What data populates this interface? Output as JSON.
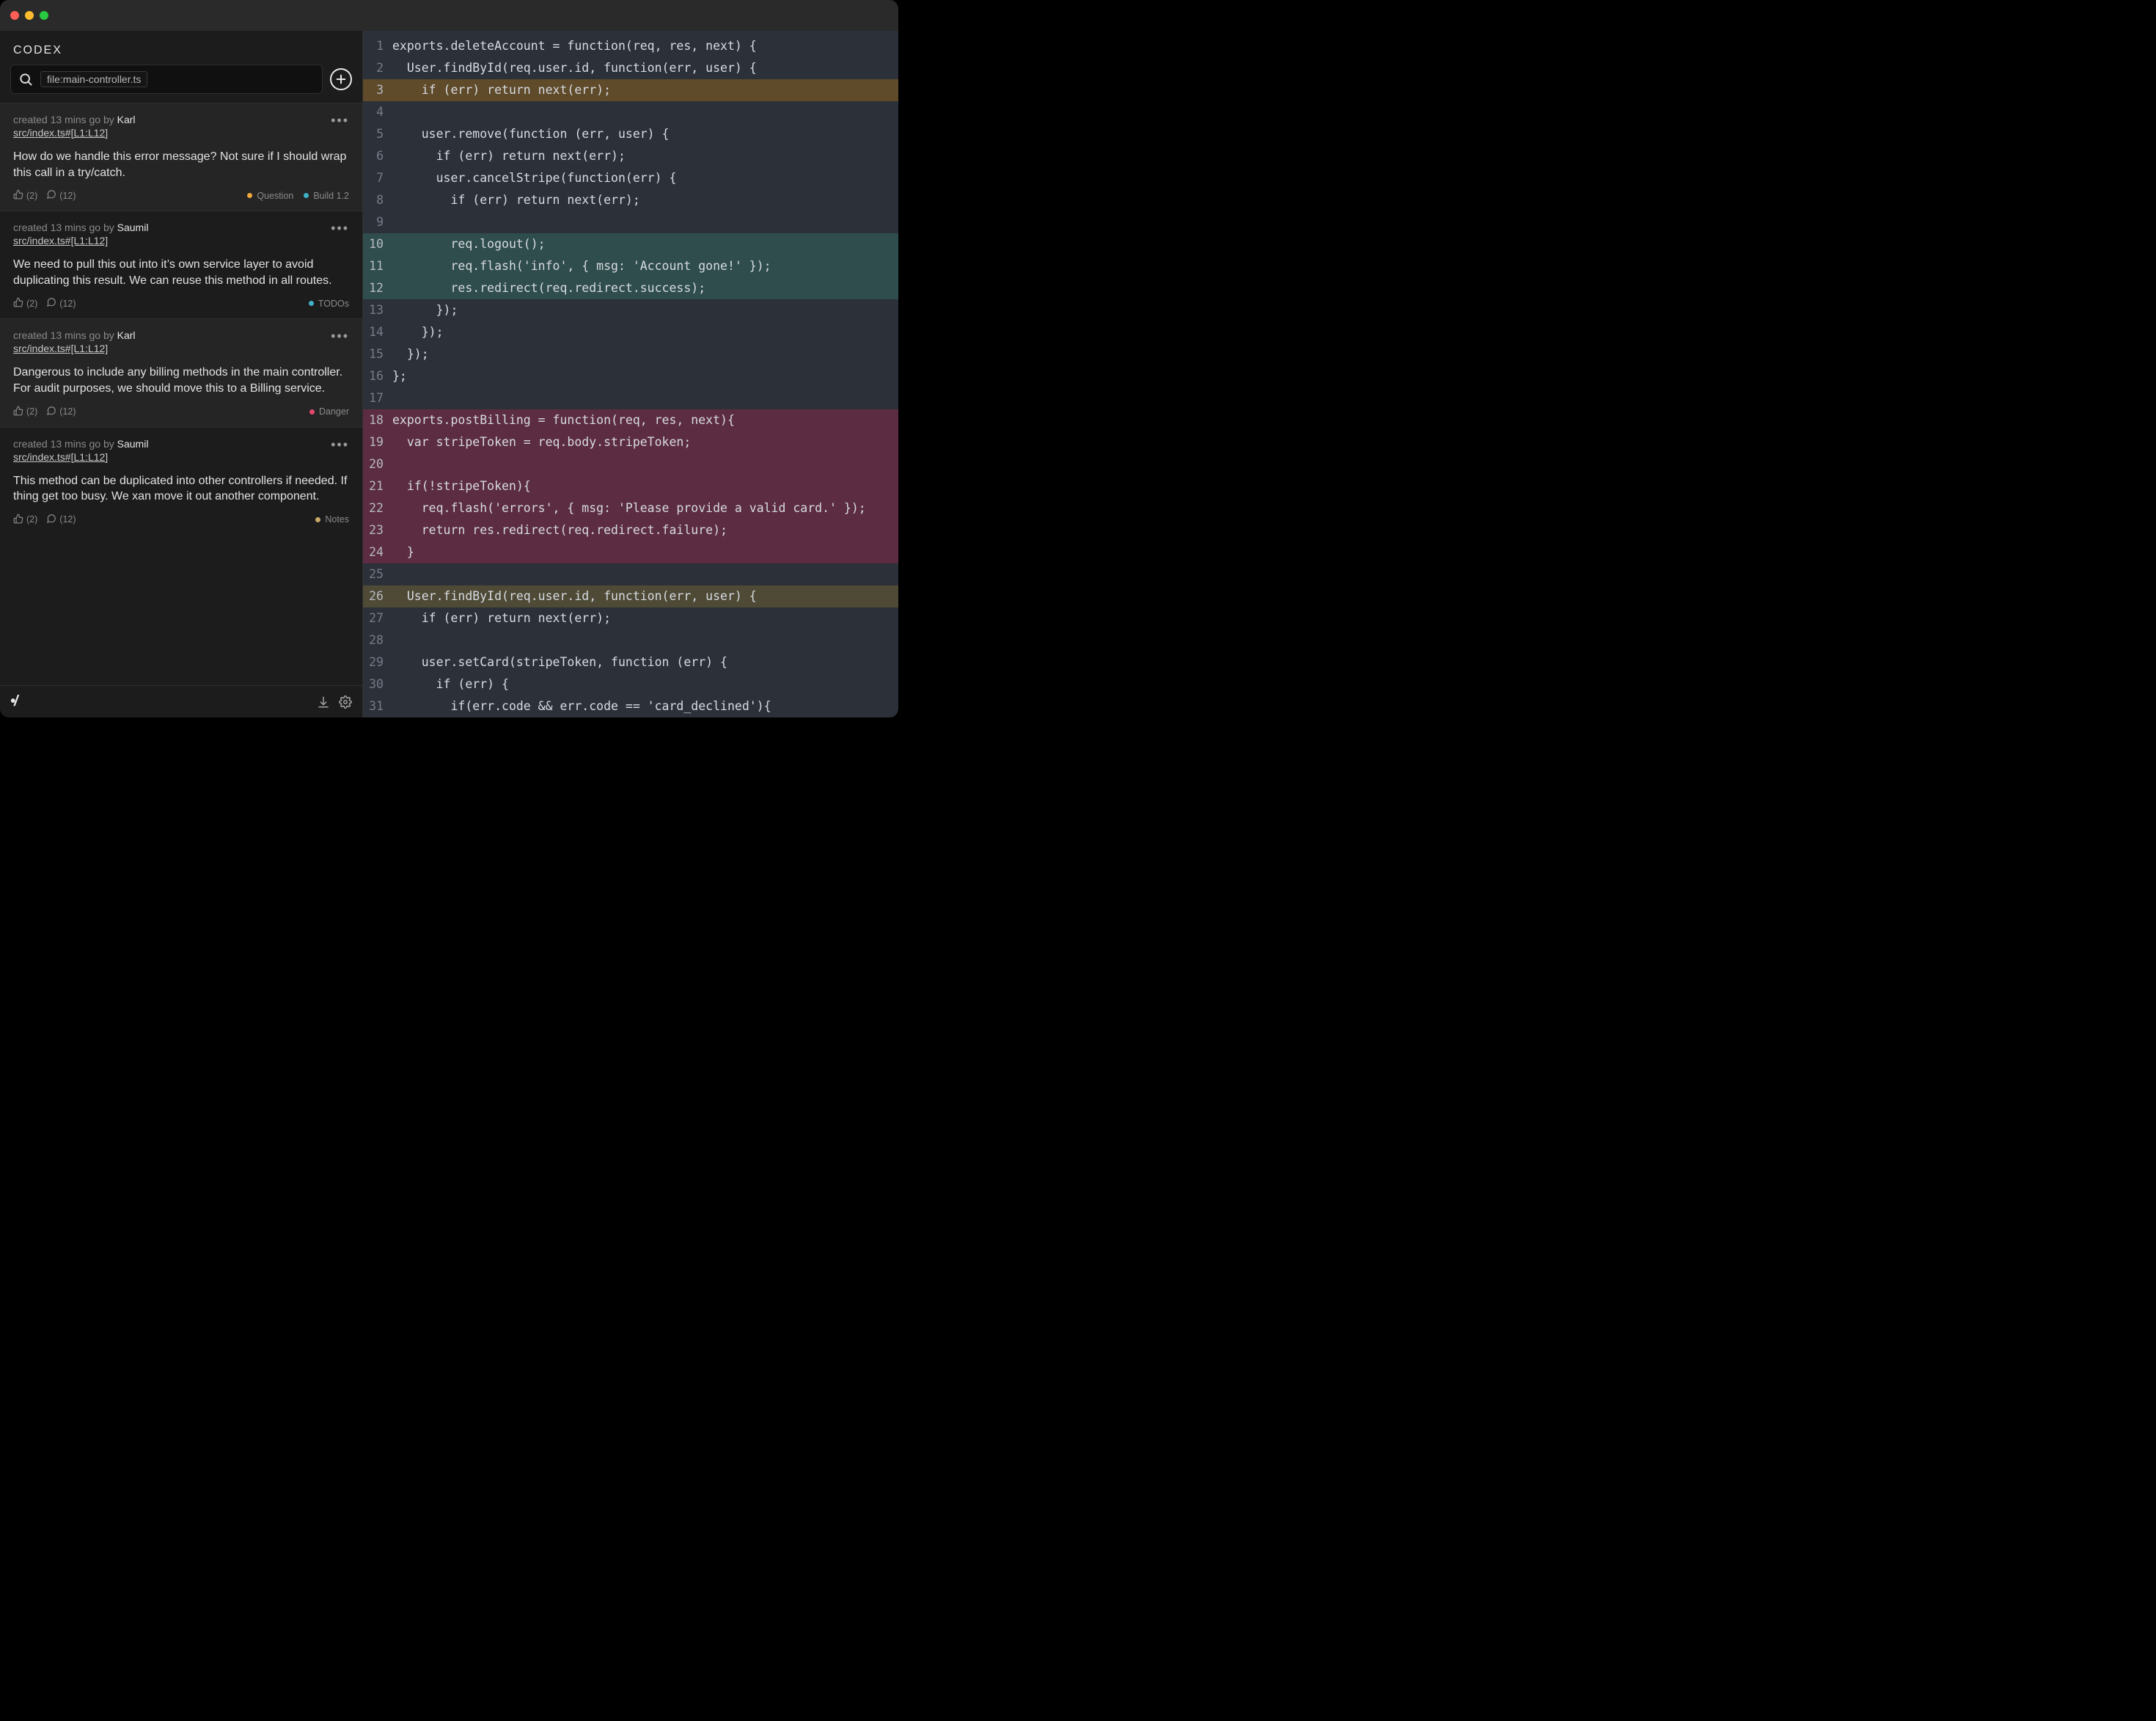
{
  "app": {
    "title": "CODEX"
  },
  "search": {
    "chip": "file:main-controller.ts"
  },
  "colors": {
    "question": "#f0a93a",
    "build": "#3fb2c9",
    "todos": "#3fb2c9",
    "danger": "#e7486f",
    "notes": "#c8a96a"
  },
  "cards": [
    {
      "alt": true,
      "created": "created 13 mins go by ",
      "author": "Karl",
      "file": "src/index.ts#[L1:L12]",
      "text": "How do we handle this error message? Not sure if I should wrap this call in a try/catch.",
      "likes": "(2)",
      "comments": "(12)",
      "tags": [
        {
          "label": "Question",
          "colorKey": "question"
        },
        {
          "label": "Build 1.2",
          "colorKey": "build"
        }
      ]
    },
    {
      "alt": false,
      "created": "created 13 mins go by ",
      "author": "Saumil",
      "file": "src/index.ts#[L1:L12]",
      "text": "We need to pull this out into it’s own service layer to avoid duplicating this result. We can reuse this method in all routes.",
      "likes": "(2)",
      "comments": "(12)",
      "tags": [
        {
          "label": "TODOs",
          "colorKey": "todos"
        }
      ]
    },
    {
      "alt": true,
      "created": "created 13 mins go by ",
      "author": "Karl",
      "file": "src/index.ts#[L1:L12]",
      "text": "Dangerous to include any billing methods in the main controller. For audit purposes, we should move this to a Billing service.",
      "likes": "(2)",
      "comments": "(12)",
      "tags": [
        {
          "label": "Danger",
          "colorKey": "danger"
        }
      ]
    },
    {
      "alt": false,
      "created": "created 13 mins go by ",
      "author": "Saumil",
      "file": "src/index.ts#[L1:L12]",
      "text": "This method can be duplicated into other controllers if needed. If thing get too busy. We xan move it out another component.",
      "likes": "(2)",
      "comments": "(12)",
      "tags": [
        {
          "label": "Notes",
          "colorKey": "notes"
        }
      ]
    }
  ],
  "code_lines": [
    {
      "n": 1,
      "t": "exports.deleteAccount = function(req, res, next) {"
    },
    {
      "n": 2,
      "t": "  User.findById(req.user.id, function(err, user) {"
    },
    {
      "n": 3,
      "t": "    if (err) return next(err);",
      "hl": "brown"
    },
    {
      "n": 4,
      "t": ""
    },
    {
      "n": 5,
      "t": "    user.remove(function (err, user) {"
    },
    {
      "n": 6,
      "t": "      if (err) return next(err);"
    },
    {
      "n": 7,
      "t": "      user.cancelStripe(function(err) {"
    },
    {
      "n": 8,
      "t": "        if (err) return next(err);"
    },
    {
      "n": 9,
      "t": ""
    },
    {
      "n": 10,
      "t": "        req.logout();",
      "hl": "teal"
    },
    {
      "n": 11,
      "t": "        req.flash('info', { msg: 'Account gone!' });",
      "hl": "teal"
    },
    {
      "n": 12,
      "t": "        res.redirect(req.redirect.success);",
      "hl": "teal"
    },
    {
      "n": 13,
      "t": "      });"
    },
    {
      "n": 14,
      "t": "    });"
    },
    {
      "n": 15,
      "t": "  });"
    },
    {
      "n": 16,
      "t": "};"
    },
    {
      "n": 17,
      "t": ""
    },
    {
      "n": 18,
      "t": "exports.postBilling = function(req, res, next){",
      "hl": "maroon"
    },
    {
      "n": 19,
      "t": "  var stripeToken = req.body.stripeToken;",
      "hl": "maroon"
    },
    {
      "n": 20,
      "t": "",
      "hl": "maroon"
    },
    {
      "n": 21,
      "t": "  if(!stripeToken){",
      "hl": "maroon"
    },
    {
      "n": 22,
      "t": "    req.flash('errors', { msg: 'Please provide a valid card.' });",
      "hl": "maroon"
    },
    {
      "n": 23,
      "t": "    return res.redirect(req.redirect.failure);",
      "hl": "maroon"
    },
    {
      "n": 24,
      "t": "  }",
      "hl": "maroon"
    },
    {
      "n": 25,
      "t": ""
    },
    {
      "n": 26,
      "t": "  User.findById(req.user.id, function(err, user) {",
      "hl": "olive"
    },
    {
      "n": 27,
      "t": "    if (err) return next(err);"
    },
    {
      "n": 28,
      "t": ""
    },
    {
      "n": 29,
      "t": "    user.setCard(stripeToken, function (err) {"
    },
    {
      "n": 30,
      "t": "      if (err) {"
    },
    {
      "n": 31,
      "t": "        if(err.code && err.code == 'card_declined'){"
    }
  ]
}
